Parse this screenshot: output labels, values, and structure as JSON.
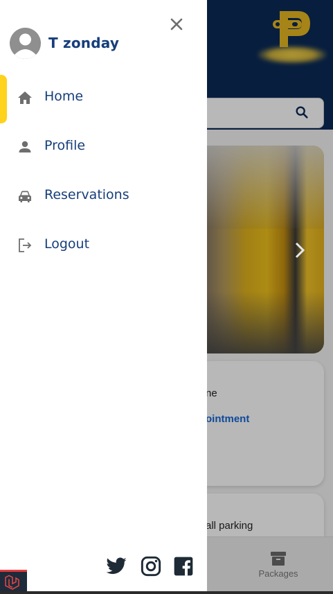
{
  "drawer": {
    "user_name": "T zonday",
    "menu": [
      {
        "label": "Home",
        "icon": "home-icon"
      },
      {
        "label": "Profile",
        "icon": "person-icon"
      },
      {
        "label": "Reservations",
        "icon": "car-icon"
      },
      {
        "label": "Logout",
        "icon": "logout-icon"
      }
    ],
    "active_item": "Home",
    "social": [
      "twitter-icon",
      "instagram-icon",
      "facebook-icon"
    ]
  },
  "background": {
    "card1_text": "ne",
    "card1_link": "ointment",
    "card2_text": "all parking",
    "bottom_nav_label": "Packages"
  },
  "colors": {
    "primary": "#163e7a",
    "header": "#0a2a57",
    "accent": "#ffd21c",
    "link": "#1566d6"
  }
}
